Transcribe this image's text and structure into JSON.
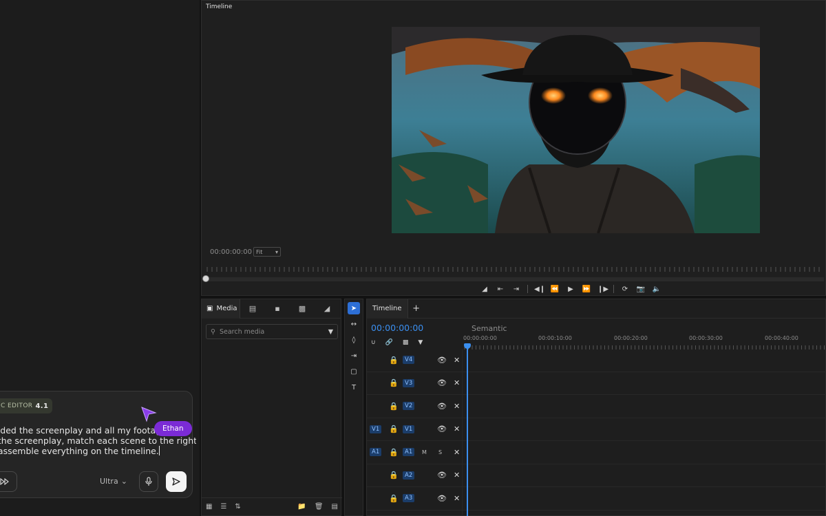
{
  "chat": {
    "model_name": "C EDITOR",
    "model_version": "4.1",
    "prompt_lines": [
      "oaded the screenplay and all my footag",
      "n the screenplay, match each scene to the right",
      "d assemble everything on the timeline."
    ],
    "quality_label": "Ultra",
    "collaborator_name": "Ethan"
  },
  "program": {
    "title": "Timeline",
    "timecode": "00:00:00:00",
    "fit_label": "Fit"
  },
  "media": {
    "tab_label": "Media",
    "search_placeholder": "Search media"
  },
  "timeline": {
    "tab_label": "Timeline",
    "add_tab": "+",
    "timecode": "00:00:00:00",
    "mode_label": "Semantic",
    "ruler_labels": [
      "00:00:00:00",
      "00:00:10:00",
      "00:00:20:00",
      "00:00:30:00",
      "00:00:40:00"
    ],
    "tracks": [
      {
        "source": "",
        "name": "V4"
      },
      {
        "source": "",
        "name": "V3"
      },
      {
        "source": "",
        "name": "V2"
      },
      {
        "source": "V1",
        "name": "V1"
      },
      {
        "source": "A1",
        "name": "A1",
        "mute": "M",
        "solo": "S"
      },
      {
        "source": "",
        "name": "A2"
      },
      {
        "source": "",
        "name": "A3"
      }
    ]
  },
  "colors": {
    "accent_blue": "#3b8ff0",
    "collaborator_purple": "#7b2bd6"
  }
}
